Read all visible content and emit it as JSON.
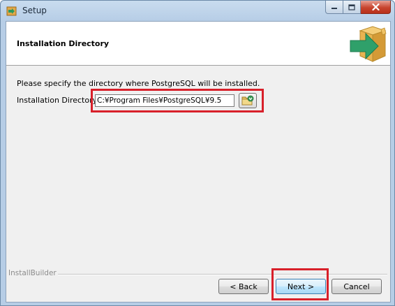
{
  "window": {
    "title": "Setup"
  },
  "header": {
    "title": "Installation Directory"
  },
  "content": {
    "instruction": "Please specify the directory where PostgreSQL will be installed.",
    "directory_label": "Installation Directory",
    "directory_value": "C:¥Program Files¥PostgreSQL¥9.5"
  },
  "footer": {
    "brand_label": "InstallBuilder",
    "back_label": "< Back",
    "next_label": "Next >",
    "cancel_label": "Cancel"
  },
  "colors": {
    "highlight": "#d8202a",
    "logo_box": "#e8b350",
    "logo_arrow": "#2fa06a"
  }
}
